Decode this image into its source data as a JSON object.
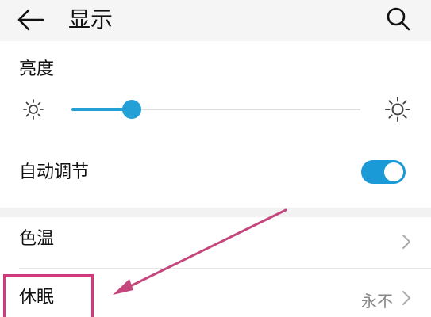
{
  "header": {
    "title": "显示"
  },
  "brightness": {
    "label": "亮度",
    "level_percent": 21
  },
  "auto_adjust": {
    "label": "自动调节",
    "enabled": true
  },
  "settings": {
    "color_temp": {
      "label": "色温"
    },
    "sleep": {
      "label": "休眠",
      "value": "永不"
    }
  },
  "colors": {
    "accent": "#1a9bd7",
    "annotation": "#d13a7c"
  },
  "icons": [
    "back-arrow-icon",
    "search-icon",
    "brightness-low-icon",
    "brightness-high-icon",
    "chevron-right-icon"
  ]
}
